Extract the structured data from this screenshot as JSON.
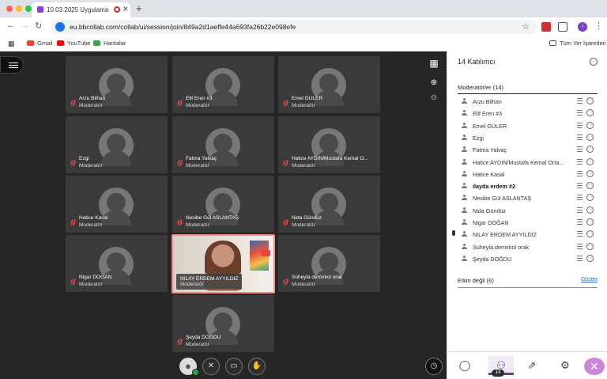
{
  "browser": {
    "tab_title": "10.03.2025 Uygulama Öğ",
    "url": "eu.bbcollab.com/collab/ui/session/join/849a2d1aeffe44a693fa26b22e098efe",
    "bookmarks": [
      {
        "label": "Gmail",
        "color": "#ea4335"
      },
      {
        "label": "YouTube",
        "color": "#ff0000"
      },
      {
        "label": "Haritalar",
        "color": "#34a853"
      }
    ],
    "all_bookmarks": "Tüm Yer İşaretleri",
    "profile_initial": "i"
  },
  "tiles": [
    {
      "name": "Arzu Bilhan",
      "role": "Moderatör"
    },
    {
      "name": "Elif Eren #3",
      "role": "Moderatör"
    },
    {
      "name": "Emel GÜLER",
      "role": "Moderatör"
    },
    {
      "name": "Ezgi",
      "role": "Moderatör"
    },
    {
      "name": "Fatma Yalvaç",
      "role": "Moderatör"
    },
    {
      "name": "Hatice AYDIN/Mustafa Kemal O...",
      "role": "Moderatör"
    },
    {
      "name": "Hatice Kasal",
      "role": "Moderatör"
    },
    {
      "name": "Nesibe Gül ASLANTAŞ",
      "role": "Moderatör"
    },
    {
      "name": "Nida Gündüz",
      "role": "Moderatör"
    },
    {
      "name": "Nigar DOĞAN",
      "role": "Moderatör"
    },
    {
      "name": "NILAY ERDEM AYYILDIZ",
      "role": "Moderatör"
    },
    {
      "name": "Süheyla demirkol orak",
      "role": "Moderatör"
    },
    {
      "name": "Şeyda DOĞDU",
      "role": "Moderatör"
    }
  ],
  "panel": {
    "title": "14 Katılımcı",
    "moderators_header": "Moderatörler (14)",
    "participants": [
      {
        "name": "Arzu Bilhan",
        "bold": false
      },
      {
        "name": "Elif Eren #3",
        "bold": false
      },
      {
        "name": "Emel GÜLER",
        "bold": false
      },
      {
        "name": "Ezgi",
        "bold": false
      },
      {
        "name": "Fatma Yalvaç",
        "bold": false
      },
      {
        "name": "Hatice AYDIN/Mustafa Kemal Orta...",
        "bold": false
      },
      {
        "name": "Hatice Kasal",
        "bold": false
      },
      {
        "name": "ilayda erdem #2",
        "bold": true
      },
      {
        "name": "Nesibe Gül ASLANTAŞ",
        "bold": false
      },
      {
        "name": "Nida Gündüz",
        "bold": false
      },
      {
        "name": "Nigar DOĞAN",
        "bold": false
      },
      {
        "name": "NILAY ERDEM AYYILDIZ",
        "bold": false
      },
      {
        "name": "Süheyla demirkol orak",
        "bold": false
      },
      {
        "name": "Şeyda DOĞDU",
        "bold": false
      }
    ],
    "inactive_label": "Etkin değil (6)",
    "show_label": "Göster",
    "participant_badge": "14"
  }
}
